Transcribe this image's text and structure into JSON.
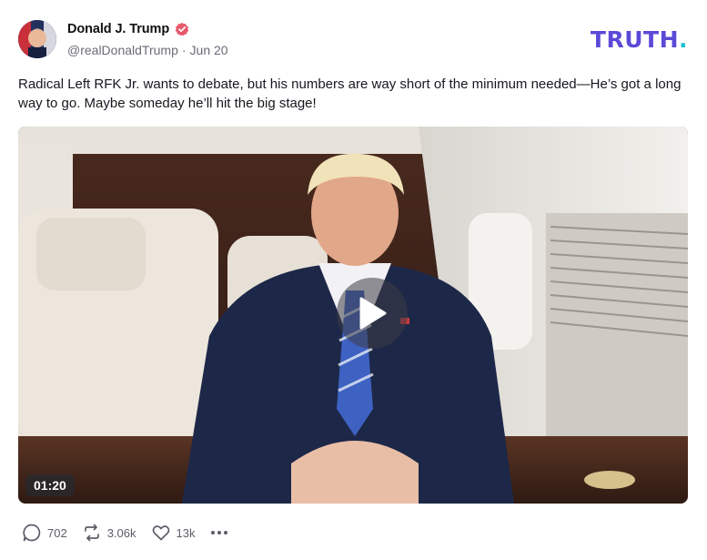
{
  "author": {
    "display_name": "Donald J. Trump",
    "handle": "@realDonaldTrump",
    "date": "Jun 20",
    "verified_icon": "verified-badge-icon",
    "verified_color": "#e8586a"
  },
  "brand": {
    "logo_text": "TRUTH",
    "logo_period": ".",
    "logo_color": "#5b4ad8",
    "period_color": "#19c1d1"
  },
  "post": {
    "text": "Radical Left RFK Jr. wants to debate, but his numbers are way short of the minimum needed—He’s got a long way to go. Maybe someday he’ll hit the big stage!"
  },
  "video": {
    "duration": "01:20",
    "play_icon": "play-icon"
  },
  "actions": {
    "replies": {
      "icon": "comment-icon",
      "count": "702"
    },
    "retruths": {
      "icon": "repost-icon",
      "count": "3.06k"
    },
    "likes": {
      "icon": "heart-icon",
      "count": "13k"
    },
    "more": {
      "icon": "more-dots-icon"
    }
  }
}
